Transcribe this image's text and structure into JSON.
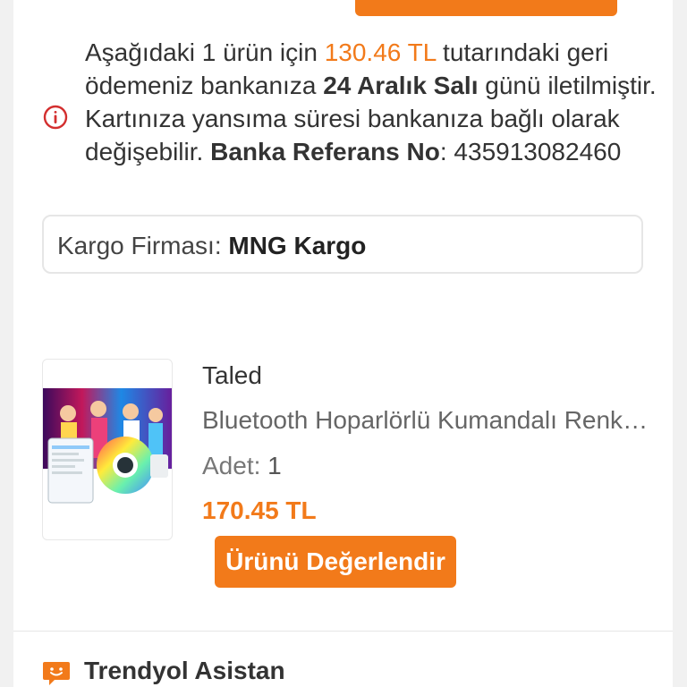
{
  "colors": {
    "accent": "#f27a1a",
    "info_red": "#d32f2f"
  },
  "notice": {
    "icon": "info-icon",
    "part1": "Aşağıdaki 1 ürün için ",
    "amount": "130.46 TL",
    "part2": " tutarındaki geri ödemeniz bankanıza ",
    "date": "24 Aralık Salı",
    "part3": " günü iletilmiştir. Kartınıza yansıma süresi bankanıza bağlı olarak değişebilir. ",
    "ref_label": "Banka Referans No",
    "ref_sep": ": ",
    "ref_value": "435913082460"
  },
  "cargo": {
    "label": "Kargo Firması: ",
    "value": "MNG Kargo"
  },
  "product": {
    "brand": "Taled",
    "name": "Bluetooth Hoparlörlü Kumandalı Renkli LED Ampul",
    "qty_label": "Adet: ",
    "qty_value": "1",
    "price": "170.45 TL",
    "review_button": "Ürünü Değerlendir",
    "image_icon": "product-image"
  },
  "assistant": {
    "icon": "chat-bubble-icon",
    "label": "Trendyol Asistan"
  }
}
